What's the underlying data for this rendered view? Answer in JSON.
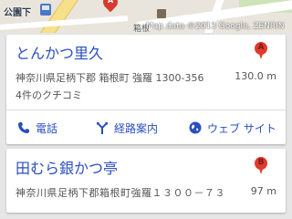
{
  "map": {
    "station_label": "公園下",
    "poi_label": "箱根",
    "copyright": "Map data ©2013 Google, ZENRIN",
    "marker_letter": "A"
  },
  "results": [
    {
      "name": "とんかつ里久",
      "marker": "A",
      "address": "神奈川県足柄下郡 箱根町 強羅 1300-356",
      "distance": "130.0 m",
      "reviews": "4件のクチコミ",
      "actions": {
        "call": "電話",
        "route": "経路案内",
        "web": "ウェブ サイト"
      }
    },
    {
      "name": "田むら銀かつ亭",
      "marker": "B",
      "address": "神奈川県足柄下郡箱根町強羅１３００－７３",
      "distance": "97 m"
    }
  ],
  "colors": {
    "link": "#2a4fbf",
    "marker": "#e03a2e",
    "background": "#e6e6e6"
  },
  "icons": [
    "bus-stop-icon",
    "map-pin-icon",
    "phone-icon",
    "route-icon",
    "globe-icon",
    "marker-a-icon",
    "marker-b-icon"
  ]
}
